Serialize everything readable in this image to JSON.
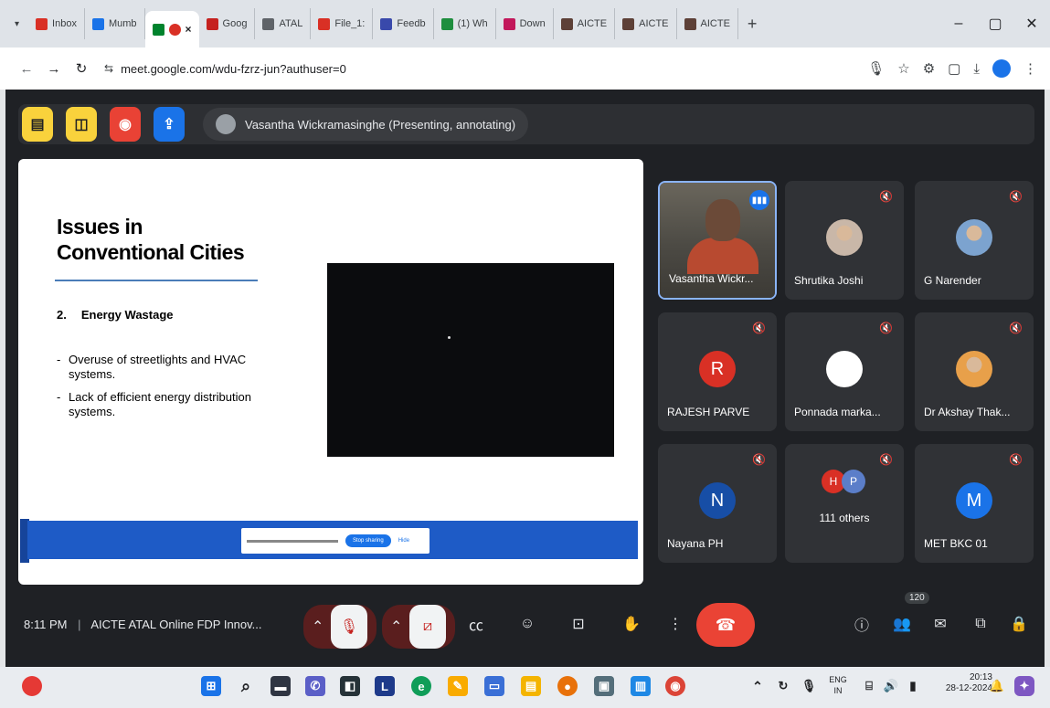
{
  "browser": {
    "tabs": [
      {
        "label": "Inbox",
        "color": "#d93025"
      },
      {
        "label": "Mumb",
        "color": "#1a73e8"
      },
      {
        "label": "",
        "color": "#00832d",
        "active": true
      },
      {
        "label": "Goog",
        "color": "#c5221f"
      },
      {
        "label": "ATAL",
        "color": "#5f6368"
      },
      {
        "label": "File_1:",
        "color": "#d93025"
      },
      {
        "label": "Feedb",
        "color": "#3949ab"
      },
      {
        "label": "(1) Wh",
        "color": "#1e8e3e"
      },
      {
        "label": "Down",
        "color": "#c2185b"
      },
      {
        "label": "AICTE",
        "color": "#5d4037"
      },
      {
        "label": "AICTE",
        "color": "#5d4037"
      },
      {
        "label": "AICTE",
        "color": "#5d4037"
      }
    ],
    "new_tab": "+",
    "minimize": "–",
    "maximize": "▢",
    "close": "✕",
    "url": "meet.google.com/wdu-fzrz-jun?authuser=0"
  },
  "meet": {
    "presenter_label": "Vasantha Wickramasinghe (Presenting, annotating)",
    "slide": {
      "title_line1": "Issues in",
      "title_line2": "Conventional Cities",
      "subhead_num": "2.",
      "subhead_text": "Energy Wastage",
      "bullets": [
        "Overuse of streetlights and HVAC systems.",
        "Lack of efficient energy distribution systems."
      ],
      "stop_sharing": "Stop sharing",
      "hide": "Hide"
    },
    "tiles": [
      {
        "name": "Vasantha Wickr...",
        "type": "video"
      },
      {
        "name": "Shrutika Joshi",
        "type": "photo",
        "color": "#c9b7a8"
      },
      {
        "name": "G Narender",
        "type": "photo",
        "color": "#7ca3cf"
      },
      {
        "name": "RAJESH PARVE",
        "type": "letter",
        "letter": "R",
        "color": "#d93025"
      },
      {
        "name": "Ponnada marka...",
        "type": "letter",
        "letter": "",
        "color": "#ffffff"
      },
      {
        "name": "Dr Akshay Thak...",
        "type": "photo",
        "color": "#e8a04a"
      },
      {
        "name": "Nayana PH",
        "type": "letter",
        "letter": "N",
        "color": "#174ea6"
      },
      {
        "name": "111 others",
        "type": "group",
        "letters": [
          "H",
          "P"
        ],
        "colors": [
          "#d93025",
          "#5b7ec9"
        ]
      },
      {
        "name": "MET BKC 01",
        "type": "letter",
        "letter": "M",
        "color": "#1a73e8"
      }
    ],
    "controls": {
      "time": "8:11 PM",
      "meeting_title": "AICTE ATAL Online FDP Innov...",
      "participant_count": "120"
    }
  },
  "taskbar": {
    "lang_top": "ENG",
    "lang_bottom": "IN",
    "time": "20:13",
    "date": "28-12-2024"
  }
}
